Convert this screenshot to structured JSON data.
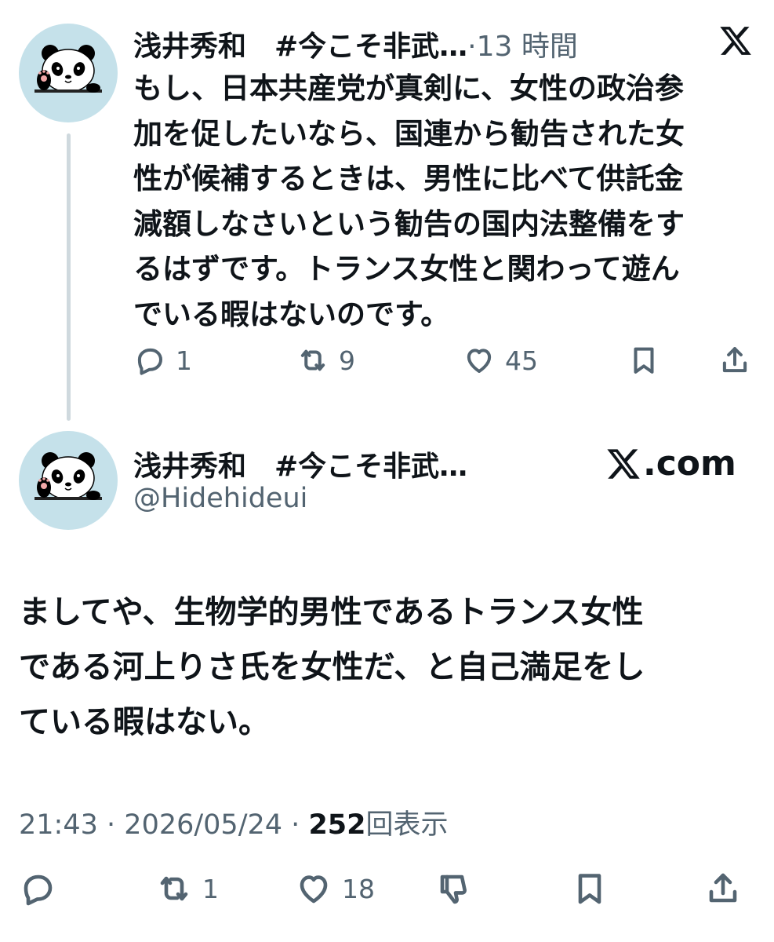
{
  "tweet1": {
    "author_name": "浅井秀和　#今こそ非武…",
    "separator": "·",
    "time_ago": "13 時間",
    "text": "もし、日本共産党が真剣に、女性の政治参加を促したいなら、国連から勧告された女性が候補するときは、男性に比べて供託金減額しなさいという勧告の国内法整備をするはずです。トランス女性と関わって遊んでいる暇はないのです。",
    "text_lines": [
      "もし、日本共産党が真剣に、女性の政治参",
      "加を促したいなら、国連から勧告された女",
      "性が候補するときは、男性に比べて供託金",
      "減額しなさいという勧告の国内法整備をす",
      "るはずです。トランス女性と関わって遊ん",
      "でいる暇はないのです。"
    ],
    "reply_count": "1",
    "repost_count": "9",
    "like_count": "45"
  },
  "tweet2": {
    "author_name": "浅井秀和　#今こそ非武…",
    "handle": "@Hidehideui",
    "source_label": ".com",
    "text_lines": [
      "ましてや、生物学的男性であるトランス女性",
      "である河上りさ氏を女性だ、と自己満足をし",
      "ている暇はない。"
    ],
    "time": "21:43",
    "date": "2026/05/24",
    "separator": "·",
    "views": "252",
    "views_label": "回表示",
    "repost_count": "1",
    "like_count": "18"
  },
  "icons": {
    "avatar": "panda-avatar-icon",
    "x_logo": "x-logo-icon",
    "reply": "speech-bubble-icon",
    "repost": "repost-arrows-icon",
    "like": "heart-icon",
    "bookmark": "bookmark-icon",
    "share": "share-upload-icon",
    "dislike": "thumbs-down-icon"
  },
  "colors": {
    "text": "#0f1419",
    "secondary": "#536471",
    "avatar_bg": "#c5e1ea",
    "thread_line": "#cfd9de"
  }
}
